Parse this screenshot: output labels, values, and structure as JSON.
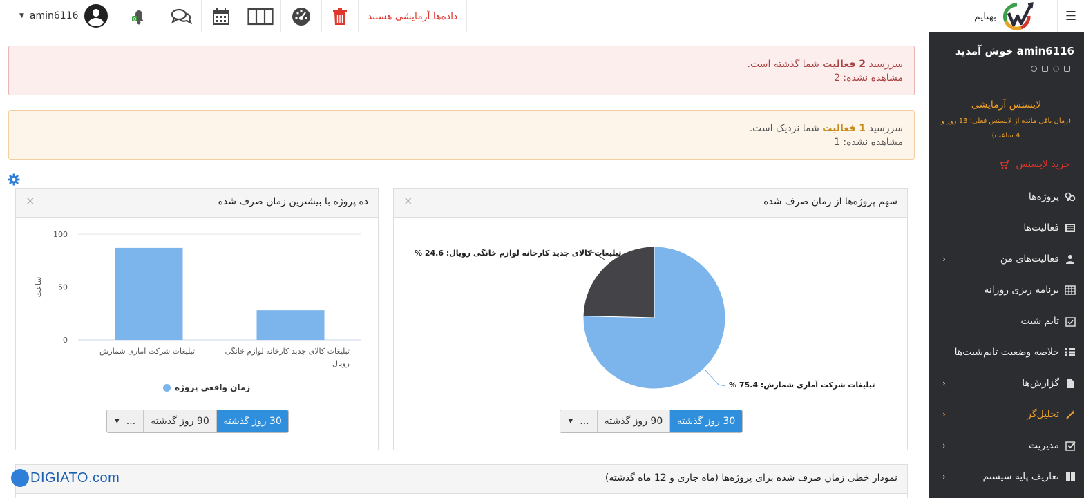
{
  "topbar": {
    "username": "amin6116",
    "trial_text": "داده‌ها آزمایشی هستند",
    "brand_name": "بهتایم"
  },
  "sidebar": {
    "welcome": "amin6116 خوش آمدید",
    "license_title": "لایسنس آزمایشی",
    "license_sub": "(زمان باقی مانده از لایسنس فعلی: 13 روز و 4 ساعت)",
    "buy_license": "خرید لایسنس",
    "items": [
      {
        "label": "پروژه‌ها",
        "icon": "projects-icon"
      },
      {
        "label": "فعالیت‌ها",
        "icon": "activities-icon"
      },
      {
        "label": "فعالیت‌های من",
        "icon": "user-icon",
        "has_submenu": true
      },
      {
        "label": "برنامه ریزی روزانه",
        "icon": "grid-icon"
      },
      {
        "label": "تایم شیت",
        "icon": "calendar-check-icon"
      },
      {
        "label": "خلاصه وضعیت تایم‌شیت‌ها",
        "icon": "list-icon"
      },
      {
        "label": "گزارش‌ها",
        "icon": "file-icon",
        "has_submenu": true
      },
      {
        "label": "تحلیل‌گر",
        "icon": "wand-icon",
        "has_submenu": true,
        "active": true
      },
      {
        "label": "مدیریت",
        "icon": "check-square-icon",
        "has_submenu": true
      },
      {
        "label": "تعاریف پایه سیستم",
        "icon": "tiles-icon",
        "has_submenu": true
      }
    ]
  },
  "alerts": {
    "overdue": {
      "prefix": "سررسید",
      "count_text": "2 فعالیت",
      "suffix": "شما گذشته است.",
      "unseen": "مشاهده نشده: 2"
    },
    "upcoming": {
      "prefix": "سررسید",
      "count_text": "1 فعالیت",
      "suffix": "شما نزدیک است.",
      "unseen": "مشاهده نشده: 1"
    }
  },
  "panels": {
    "pie": {
      "title": "سهم پروژه‌ها از زمان صرف شده",
      "close": "×"
    },
    "bar": {
      "title": "ده پروژه با بیشترین زمان صرف شده",
      "close": "×"
    },
    "line": {
      "title": "نمودار خطی زمان صرف شده برای پروژه‌ها (ماه جاری و 12 ماه گذشته)"
    }
  },
  "range_buttons": {
    "days30": "30 روز گذشته",
    "days90": "90 روز گذشته",
    "more": "..."
  },
  "chart_data": [
    {
      "type": "pie",
      "title": "سهم پروژه‌ها از زمان صرف شده",
      "slices": [
        {
          "label": "تبلیغات شرکت آماری شمارش: 75.4 %",
          "name": "تبلیغات شرکت آماری شمارش",
          "value": 75.4,
          "color": "#7cb5ec"
        },
        {
          "label": "تبلیغات کالای جدید کارخانه لوازم خانگی رویال: 24.6 %",
          "name": "تبلیغات کالای جدید کارخانه لوازم خانگی رویال",
          "value": 24.6,
          "color": "#434348"
        }
      ]
    },
    {
      "type": "bar",
      "title": "ده پروژه با بیشترین زمان صرف شده",
      "categories": [
        "تبلیغات شرکت آماری شمارش",
        "تبلیغات کالای جدید کارخانه لوازم خانگی رویال"
      ],
      "series": [
        {
          "name": "زمان واقعی پروژه",
          "values": [
            87,
            28
          ],
          "color": "#7cb5ec"
        }
      ],
      "ylabel": "ساعت",
      "yticks": [
        0,
        50,
        100
      ],
      "ylim": [
        0,
        100
      ]
    }
  ],
  "watermark": {
    "brand": "DIGIATO",
    "dot": ".",
    "tld": "com"
  }
}
